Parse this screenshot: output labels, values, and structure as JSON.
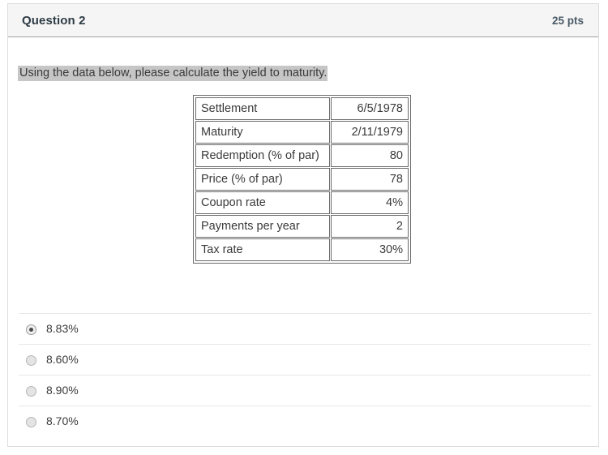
{
  "header": {
    "title": "Question 2",
    "points": "25 pts"
  },
  "prompt": {
    "text": "Using the data below, please calculate the yield to maturity."
  },
  "data_table": {
    "rows": [
      {
        "label": "Settlement",
        "value": "6/5/1978"
      },
      {
        "label": "Maturity",
        "value": "2/11/1979"
      },
      {
        "label": "Redemption (% of par)",
        "value": "80"
      },
      {
        "label": "Price (% of par)",
        "value": "78"
      },
      {
        "label": "Coupon rate",
        "value": "4%"
      },
      {
        "label": "Payments per year",
        "value": "2"
      },
      {
        "label": "Tax rate",
        "value": "30%"
      }
    ]
  },
  "answers": {
    "options": [
      {
        "label": "8.83%",
        "selected": true
      },
      {
        "label": "8.60%",
        "selected": false
      },
      {
        "label": "8.90%",
        "selected": false
      },
      {
        "label": "8.70%",
        "selected": false
      }
    ]
  },
  "colors": {
    "header_bg": "#f5f5f5",
    "header_border": "#a1a1a1",
    "container_border": "#dcdcdc",
    "highlight_bg": "#c6c6c6",
    "table_border": "#6b6b6b",
    "row_divider": "#e8e8e8",
    "text": "#3a3a3a",
    "radio_selected_dot": "#4a4a4a"
  }
}
